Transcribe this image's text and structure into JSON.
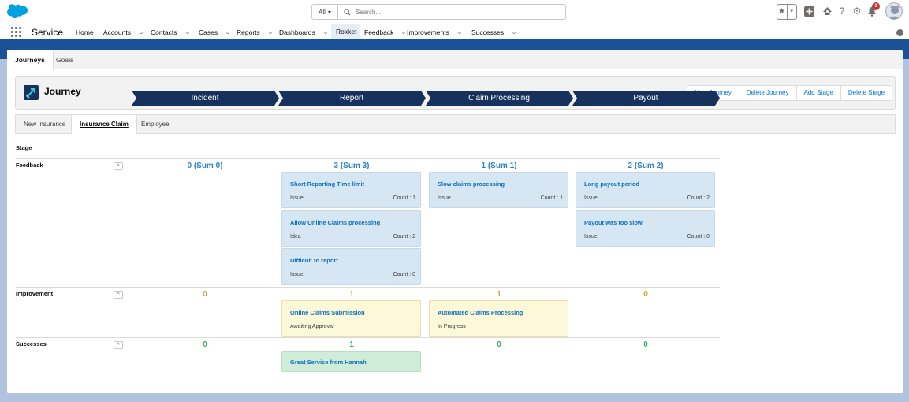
{
  "header": {
    "search_scope": "All",
    "search_placeholder": "Search...",
    "notification_count": "1"
  },
  "nav": {
    "app_name": "Service",
    "items": [
      {
        "label": "Home",
        "has_menu": false
      },
      {
        "label": "Accounts",
        "has_menu": true
      },
      {
        "label": "Contacts",
        "has_menu": true
      },
      {
        "label": "Cases",
        "has_menu": true
      },
      {
        "label": "Reports",
        "has_menu": true
      },
      {
        "label": "Dashboards",
        "has_menu": true
      },
      {
        "label": "Rokket",
        "has_menu": false,
        "active": true
      },
      {
        "label": "Feedback",
        "has_menu": true
      },
      {
        "label": "Improvements",
        "has_menu": true
      },
      {
        "label": "Successes",
        "has_menu": true
      }
    ]
  },
  "tabs": [
    "Journeys",
    "Goals"
  ],
  "journey": {
    "title": "Journey",
    "buttons": [
      "New Journey",
      "Delete Journey",
      "Add Stage",
      "Delete Stage"
    ]
  },
  "subtabs": [
    "New Insurance",
    "Insurance Claim",
    "Employee"
  ],
  "board": {
    "stage_label": "Stage",
    "stages": [
      "Incident",
      "Report",
      "Claim Processing",
      "Payout"
    ],
    "rows": [
      {
        "label": "Feedback",
        "sums": [
          "0 (Sum 0)",
          "3 (Sum 3)",
          "1 (Sum 1)",
          "2 (Sum 2)"
        ],
        "cards": [
          [],
          [
            {
              "title": "Short Reporting Time limit",
              "sub": "Issue",
              "count": "Count : 1"
            },
            {
              "title": "Allow Online Claims processing",
              "sub": "Idea",
              "count": "Count : 2"
            },
            {
              "title": "Difficult to report",
              "sub": "Issue",
              "count": "Count : 0"
            }
          ],
          [
            {
              "title": "Slow claims processing",
              "sub": "Issue",
              "count": "Count : 1"
            }
          ],
          [
            {
              "title": "Long payout period",
              "sub": "Issue",
              "count": "Count : 2"
            },
            {
              "title": "Payout was too slow",
              "sub": "Issue",
              "count": "Count : 0"
            }
          ]
        ]
      },
      {
        "label": "Improvement",
        "sums": [
          "0",
          "1",
          "1",
          "0"
        ],
        "cards": [
          [],
          [
            {
              "title": "Online Claims Submission",
              "sub": "Awaiting Approval"
            }
          ],
          [
            {
              "title": "Automated Claims Processing",
              "sub": "In Progress"
            }
          ],
          []
        ]
      },
      {
        "label": "Successes",
        "sums": [
          "0",
          "1",
          "0",
          "0"
        ],
        "cards": [
          [],
          [
            {
              "title": "Great Service from Hannah"
            }
          ],
          [],
          []
        ]
      }
    ]
  },
  "colors": {
    "brand_blue": "#1b5297",
    "stage_dark": "#16325c",
    "feedback_sum": "#2a82c8",
    "improvement_sum": "#d4a23b",
    "success_sum": "#3aad60"
  }
}
